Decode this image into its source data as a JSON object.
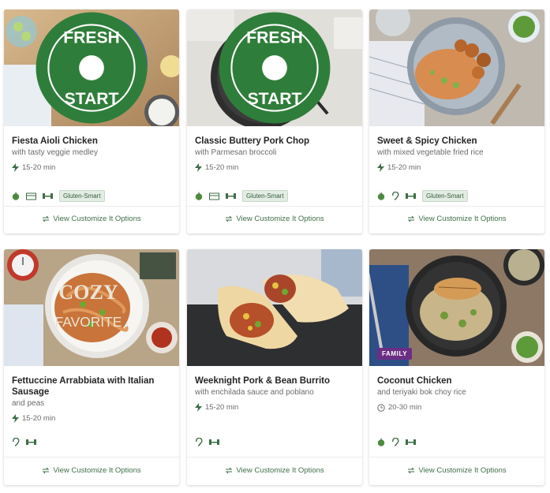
{
  "colors": {
    "accent": "#3f6e47",
    "tag_bg": "#e3ede4",
    "family_badge": "#6b2e84",
    "fresh_start_badge": "#2f7d3a"
  },
  "cta_label": "View Customize It Options",
  "cards": [
    {
      "title": "Fiesta Aioli Chicken",
      "subtitle": "with tasty veggie medley",
      "time": "15-20 min",
      "time_icon": "lightning-icon",
      "icons": [
        "apple-icon",
        "bowl-icon",
        "dumbbell-icon"
      ],
      "tag": "Gluten-Smart",
      "badge": "FRESH START"
    },
    {
      "title": "Classic Buttery Pork Chop",
      "subtitle": "with Parmesan broccoli",
      "time": "15-20 min",
      "time_icon": "lightning-icon",
      "icons": [
        "apple-icon",
        "bowl-icon",
        "dumbbell-icon"
      ],
      "tag": "Gluten-Smart",
      "badge": "FRESH START"
    },
    {
      "title": "Sweet & Spicy Chicken",
      "subtitle": "with mixed vegetable fried rice",
      "time": "15-20 min",
      "time_icon": "lightning-icon",
      "icons": [
        "apple-icon",
        "ear-icon",
        "dumbbell-icon"
      ],
      "tag": "Gluten-Smart"
    },
    {
      "title": "Fettuccine Arrabbiata with Italian Sausage",
      "subtitle": "and peas",
      "time": "15-20 min",
      "time_icon": "lightning-icon",
      "icons": [
        "ear-icon",
        "dumbbell-icon"
      ],
      "badge": "COZY FAVORITE"
    },
    {
      "title": "Weeknight Pork & Bean Burrito",
      "subtitle": "with enchilada sauce and poblano",
      "time": "15-20 min",
      "time_icon": "lightning-icon",
      "icons": [
        "ear-icon",
        "dumbbell-icon"
      ]
    },
    {
      "title": "Coconut Chicken",
      "subtitle": "and teriyaki bok choy rice",
      "time": "20-30 min",
      "time_icon": "clock-icon",
      "icons": [
        "apple-icon",
        "ear-icon",
        "dumbbell-icon"
      ],
      "badge": "FAMILY"
    }
  ]
}
